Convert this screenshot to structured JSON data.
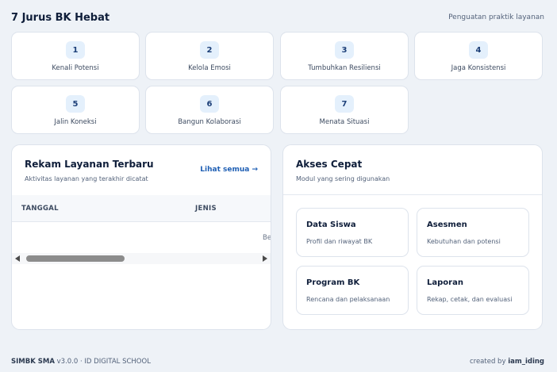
{
  "header": {
    "title": "7 Jurus BK Hebat",
    "subtitle": "Penguatan praktik layanan"
  },
  "steps": [
    {
      "number": "1",
      "label": "Kenali Potensi"
    },
    {
      "number": "2",
      "label": "Kelola Emosi"
    },
    {
      "number": "3",
      "label": "Tumbuhkan Resiliensi"
    },
    {
      "number": "4",
      "label": "Jaga Konsistensi"
    },
    {
      "number": "5",
      "label": "Jalin Koneksi"
    },
    {
      "number": "6",
      "label": "Bangun Kolaborasi"
    },
    {
      "number": "7",
      "label": "Menata Situasi"
    }
  ],
  "records": {
    "title": "Rekam Layanan Terbaru",
    "subtitle": "Aktivitas layanan yang terakhir dicatat",
    "see_all": "Lihat semua →",
    "columns": [
      "TANGGAL",
      "JENIS"
    ],
    "empty_text": "Be"
  },
  "quick_access": {
    "title": "Akses Cepat",
    "subtitle": "Modul yang sering digunakan",
    "modules": [
      {
        "title": "Data Siswa",
        "subtitle": "Profil dan riwayat BK"
      },
      {
        "title": "Asesmen",
        "subtitle": "Kebutuhan dan potensi"
      },
      {
        "title": "Program BK",
        "subtitle": "Rencana dan pelaksanaan"
      },
      {
        "title": "Laporan",
        "subtitle": "Rekap, cetak, dan evaluasi"
      }
    ]
  },
  "footer": {
    "app_name": "SIMBK SMA",
    "version_info": "v3.0.0 · ID DIGITAL SCHOOL",
    "created_prefix": "created by",
    "author": "iam_iding"
  }
}
